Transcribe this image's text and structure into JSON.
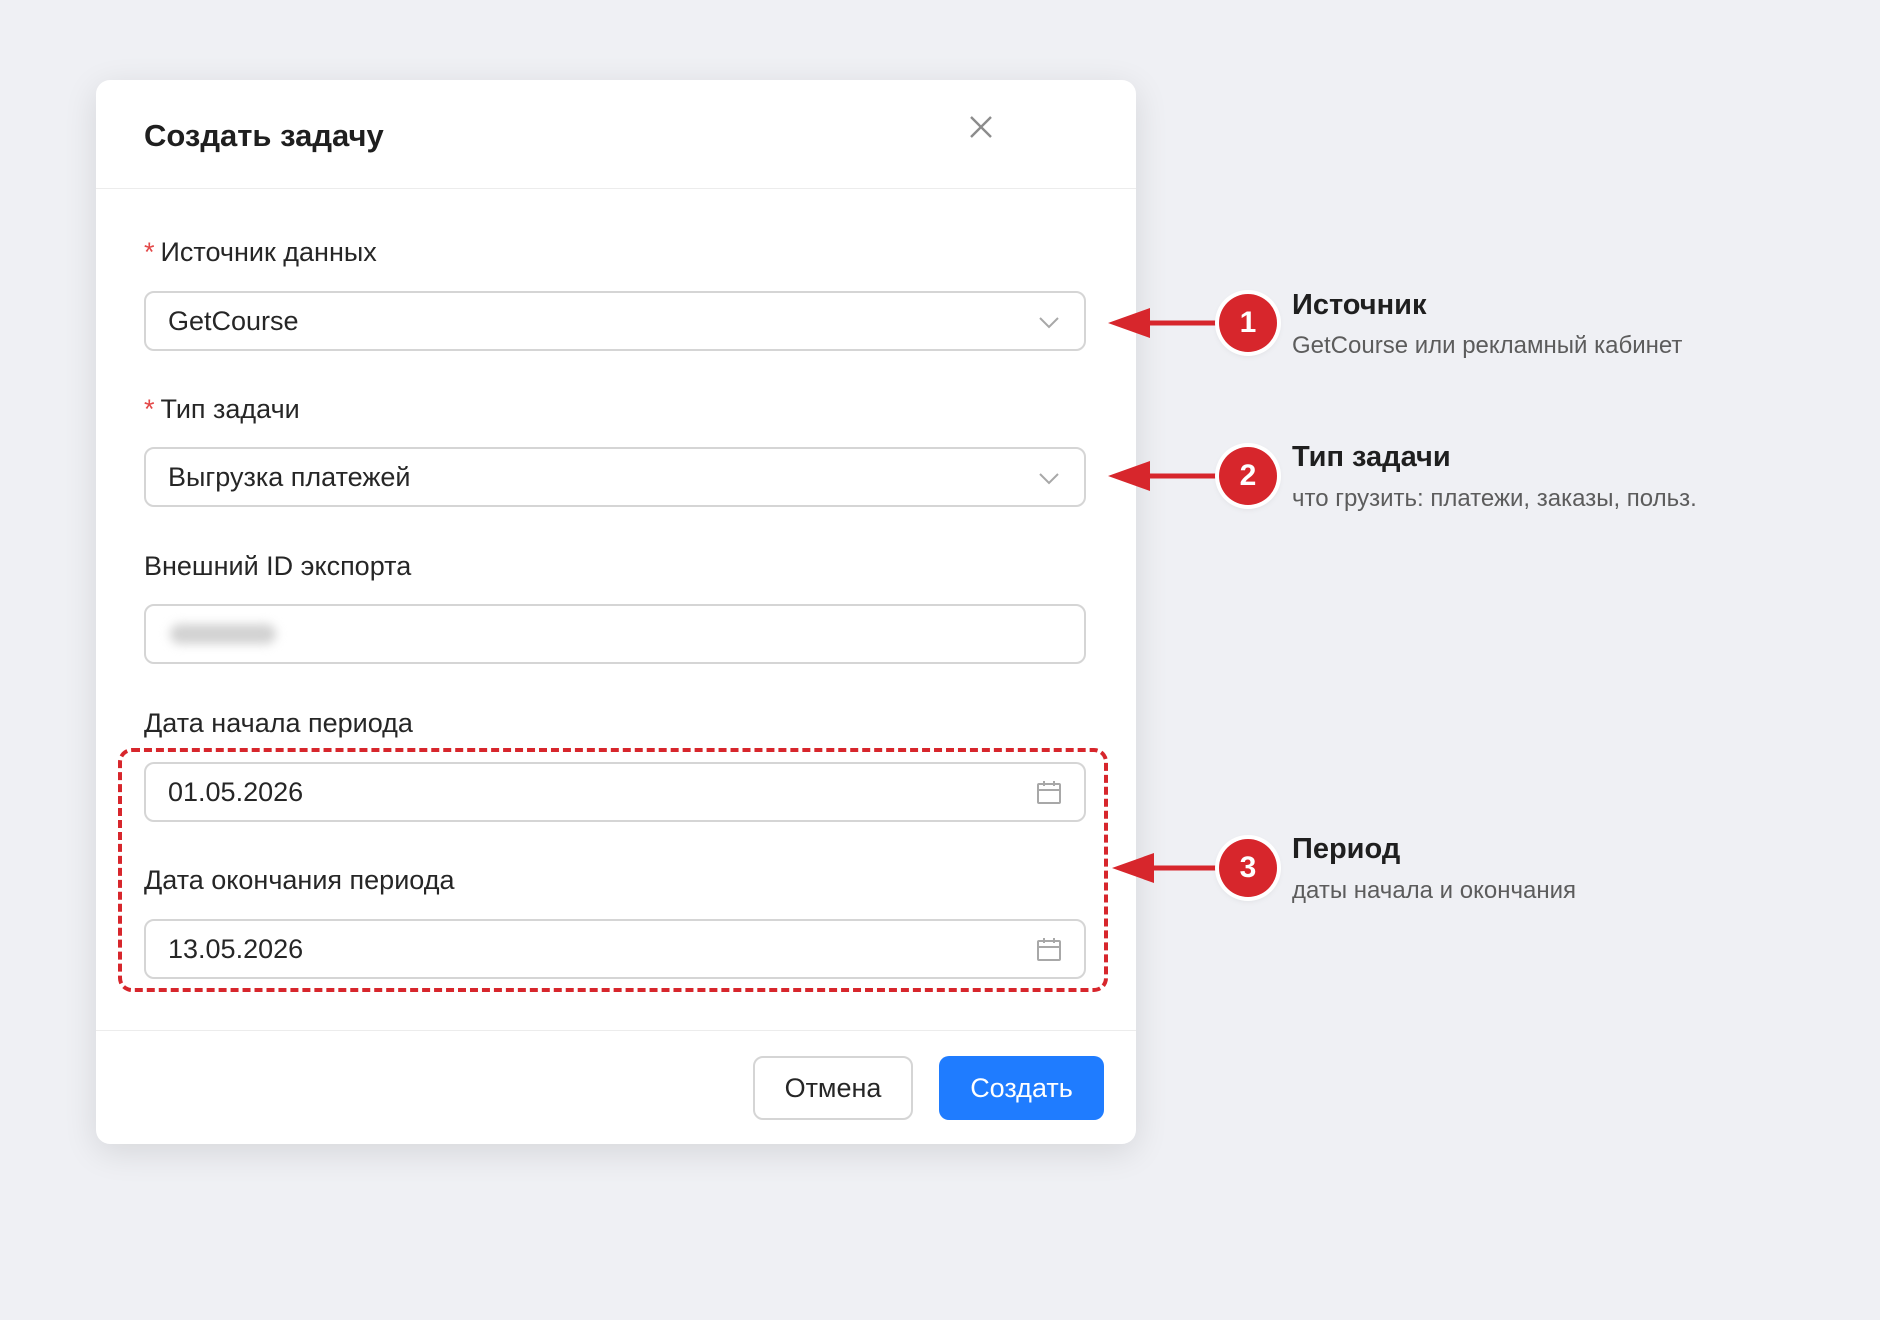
{
  "modal": {
    "title": "Создать задачу",
    "fields": {
      "source": {
        "label": "Источник данных",
        "required_mark": "*",
        "value": "GetCourse"
      },
      "task_type": {
        "label": "Тип задачи",
        "required_mark": "*",
        "value": "Выгрузка платежей"
      },
      "external_id": {
        "label": "Внешний ID экспорта",
        "value_state": "blurred"
      },
      "start_date": {
        "label": "Дата начала периода",
        "value": "01.05.2026"
      },
      "end_date": {
        "label": "Дата окончания периода",
        "value": "13.05.2026"
      }
    },
    "buttons": {
      "cancel": "Отмена",
      "create": "Создать"
    }
  },
  "annotations": [
    {
      "number": "1",
      "title": "Источник",
      "description": "GetCourse или рекламный кабинет"
    },
    {
      "number": "2",
      "title": "Тип задачи",
      "description": "что грузить: платежи, заказы, польз."
    },
    {
      "number": "3",
      "title": "Период",
      "description": "даты начала и окончания"
    }
  ],
  "colors": {
    "background": "#eff0f4",
    "accent": "#1f7cff",
    "annotation": "#d7262c",
    "required": "#e34848"
  },
  "icons": {
    "close": "close-icon",
    "dropdown": "chevron-down-icon",
    "date": "calendar-icon"
  }
}
